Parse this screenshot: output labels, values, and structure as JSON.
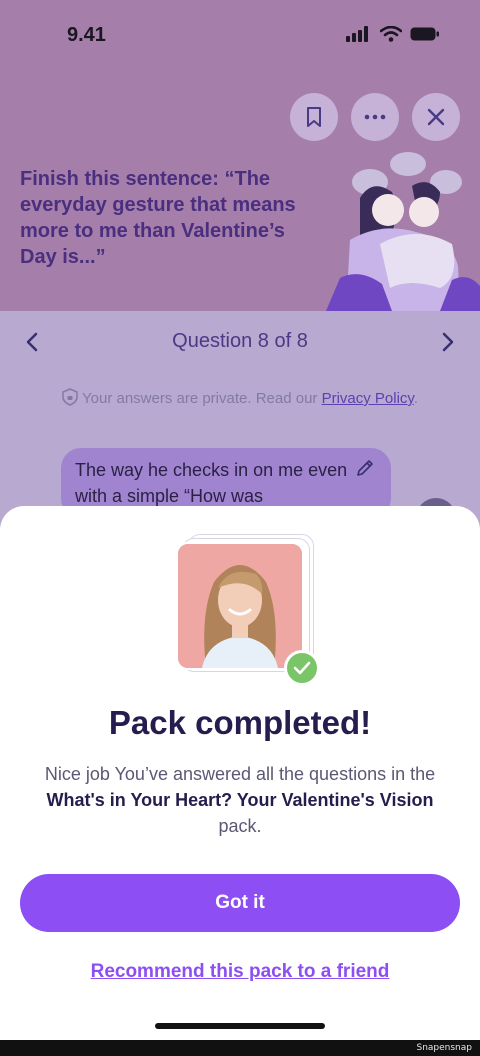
{
  "status_bar": {
    "time": "9.41"
  },
  "question": {
    "text": "Finish this sentence: “The everyday gesture that means more to me than Valentine’s Day is...”"
  },
  "navigation": {
    "label": "Question 8 of 8"
  },
  "privacy": {
    "prefix": "Your answers are private. Read our ",
    "link": "Privacy Policy",
    "suffix": "."
  },
  "answer": {
    "text": "The way he checks in on me even with a simple “How was"
  },
  "sheet": {
    "title": "Pack completed!",
    "body_prefix": "Nice job You’ve answered all the questions in the ",
    "pack_name": "What's in Your Heart? Your Valentine's Vision",
    "body_suffix": " pack.",
    "primary_button": "Got it",
    "secondary_link": "Recommend this pack to a friend"
  },
  "watermark": "Snapensnap",
  "colors": {
    "header_bg": "#a57fa9",
    "accent": "#8d4ef3",
    "check": "#79c567",
    "title": "#261c4d"
  },
  "icons": [
    "bookmark-icon",
    "more-icon",
    "close-icon",
    "chevron-left-icon",
    "chevron-right-icon",
    "shield-icon",
    "pencil-icon",
    "check-icon"
  ]
}
